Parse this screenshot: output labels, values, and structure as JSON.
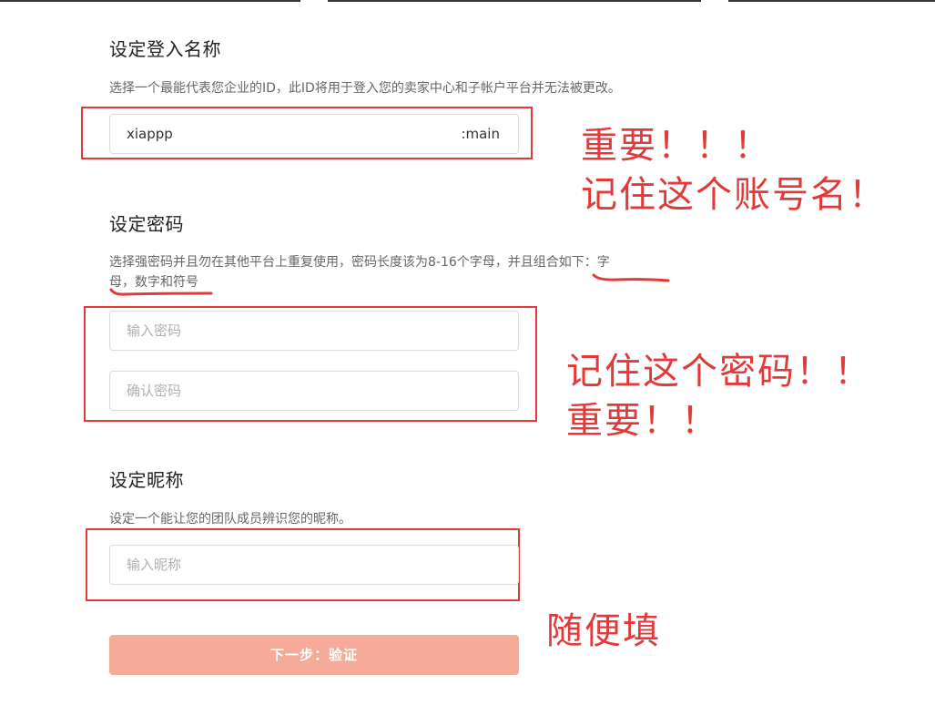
{
  "username": {
    "title": "设定登入名称",
    "description": "选择一个最能代表您企业的ID，此ID将用于登入您的卖家中心和子帐户平台并无法被更改。",
    "value": "xiappp",
    "suffix": ":main"
  },
  "password": {
    "title": "设定密码",
    "description_line1": "选择强密码并且勿在其他平台上重复使用，密码长度该为8-16个字母，并且组合如下：字",
    "description_line2": "母，数字和符号",
    "password_placeholder": "输入密码",
    "confirm_placeholder": "确认密码"
  },
  "nickname": {
    "title": "设定昵称",
    "description": "设定一个能让您的团队成员辨识您的昵称。",
    "placeholder": "输入昵称"
  },
  "submit_label": "下一步：验证",
  "annotations": {
    "username_note_line1": "重要！！！",
    "username_note_line2": "记住这个账号名！",
    "password_note_line1": "记住这个密码！！",
    "password_note_line2": "重要！！",
    "nickname_note": "随便填"
  },
  "colors": {
    "annotation_red": "#e23a3a",
    "button_bg": "#f6ab9a"
  }
}
